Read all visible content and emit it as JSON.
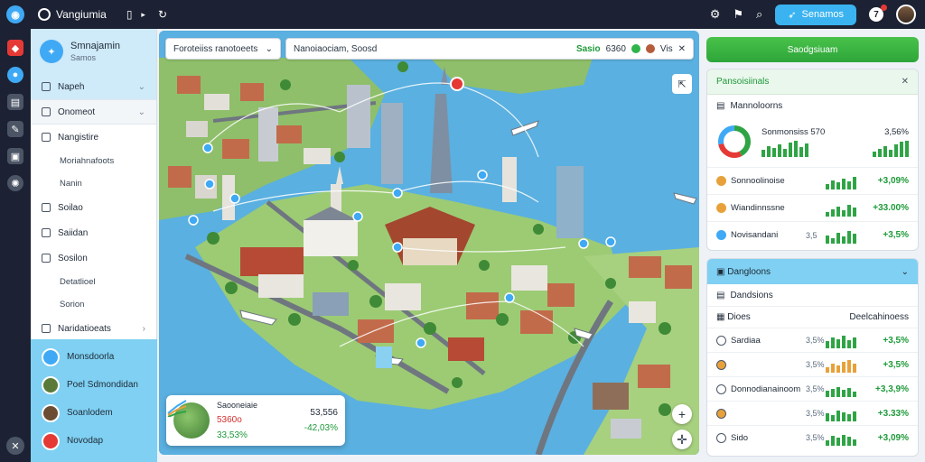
{
  "topbar": {
    "brand": "Vangiumia",
    "action_label": "Senamos",
    "notif_count": "7"
  },
  "sidebar": {
    "profile_name": "Smnajamin",
    "profile_sub": "Samos",
    "items": [
      {
        "label": "Napeh",
        "type": "main",
        "state": "active",
        "chev": "⌄"
      },
      {
        "label": "Onomeot",
        "type": "main",
        "state": "hover",
        "chev": "⌄"
      },
      {
        "label": "Nangistire",
        "type": "main",
        "state": "",
        "chev": ""
      },
      {
        "label": "Moriahnafoots",
        "type": "sub",
        "state": "",
        "chev": ""
      },
      {
        "label": "Nanin",
        "type": "sub",
        "state": "",
        "chev": ""
      },
      {
        "label": "Soilao",
        "type": "main",
        "state": "",
        "chev": ""
      },
      {
        "label": "Saiidan",
        "type": "main",
        "state": "",
        "chev": ""
      },
      {
        "label": "Sosilon",
        "type": "main",
        "state": "",
        "chev": ""
      },
      {
        "label": "Detatlioel",
        "type": "sub",
        "state": "",
        "chev": ""
      },
      {
        "label": "Sorion",
        "type": "sub",
        "state": "",
        "chev": ""
      },
      {
        "label": "Naridatioeats",
        "type": "main",
        "state": "",
        "chev": "›"
      }
    ],
    "bottom_items": [
      "Monsdoorla",
      "Poel Sdmondidan",
      "Soanlodem",
      "Novodap"
    ]
  },
  "map": {
    "search1": "Foroteiiss ranotoeets",
    "search2": "Nanoiaociam, Soosd",
    "search2_right": "Sasio",
    "search2_num": "6360",
    "search2_tag": "Vis",
    "card": {
      "title": "Saooneiaie",
      "red_val": "5360o",
      "green_val": "33,53%",
      "right1": "53,556",
      "right2": "-42,03%"
    }
  },
  "right": {
    "button_label": "Saodgsiuam",
    "panel1": {
      "title": "Pansoisiinals",
      "subtitle": "Mannoloorns",
      "summary_label": "Sonmonsiss 570",
      "summary_val": "3,56%",
      "rows": [
        {
          "name": "Sonnoolinoise",
          "pct": "",
          "val": "+3,09%",
          "color": "#e8a13a"
        },
        {
          "name": "Wiandinnssne",
          "pct": "",
          "val": "+33.00%",
          "color": "#e8a13a"
        },
        {
          "name": "Novisandani",
          "pct": "3,5",
          "val": "+3,5%",
          "color": "#3fa9f5"
        }
      ]
    },
    "panel2": {
      "title": "Dangloons",
      "subtitle": "Dandsions",
      "col1": "Dioes",
      "col2": "Deelcahinoess",
      "rows": [
        {
          "name": "Sardiaa",
          "pct": "3,5%",
          "val": "+3,5%"
        },
        {
          "name": "",
          "pct": "3,5%",
          "val": "+3,5%"
        },
        {
          "name": "Donnodianainoom",
          "pct": "3,5%",
          "val": "+3,3,9%"
        },
        {
          "name": "",
          "pct": "3,5%",
          "val": "+3.33%"
        },
        {
          "name": "Sido",
          "pct": "3,5%",
          "val": "+3,09%"
        }
      ]
    }
  },
  "colors": {
    "topbar": "#1c2233",
    "accent": "#3ab3f0",
    "green": "#2ea53a",
    "sidebar_highlight": "#cfeaf9"
  }
}
